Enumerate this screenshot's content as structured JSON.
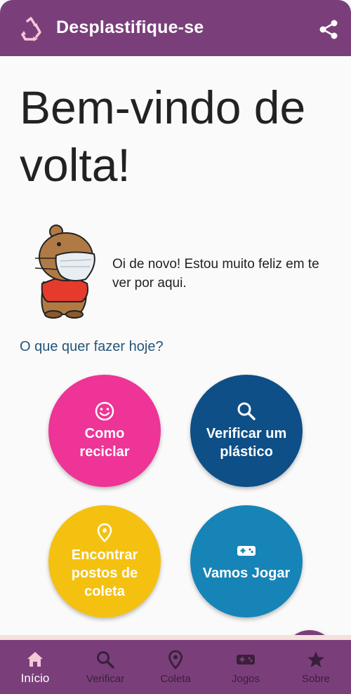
{
  "app": {
    "title": "Desplastifique-se",
    "bar_color": "#7a3f7a"
  },
  "main": {
    "welcome": "Bem-vindo de volta!",
    "mascot_message": "Oi de novo! Estou muito feliz em te ver por aqui.",
    "question": "O que quer fazer hoje?"
  },
  "actions": [
    {
      "label": "Como reciclar",
      "icon": "smiley-icon",
      "color": "#ee3496"
    },
    {
      "label": "Verificar um plástico",
      "icon": "search-icon",
      "color": "#0d4f86"
    },
    {
      "label": "Encontrar postos de coleta",
      "icon": "location-pin-icon",
      "color": "#f5c110"
    },
    {
      "label": "Vamos Jogar",
      "icon": "gamepad-icon",
      "color": "#1784b7"
    }
  ],
  "fab": {
    "icon": "menu-icon"
  },
  "bottom_nav": [
    {
      "label": "Início",
      "icon": "home-icon",
      "active": true
    },
    {
      "label": "Verificar",
      "icon": "search-icon",
      "active": false
    },
    {
      "label": "Coleta",
      "icon": "location-pin-icon",
      "active": false
    },
    {
      "label": "Jogos",
      "icon": "gamepad-icon",
      "active": false
    },
    {
      "label": "Sobre",
      "icon": "star-icon",
      "active": false
    }
  ]
}
